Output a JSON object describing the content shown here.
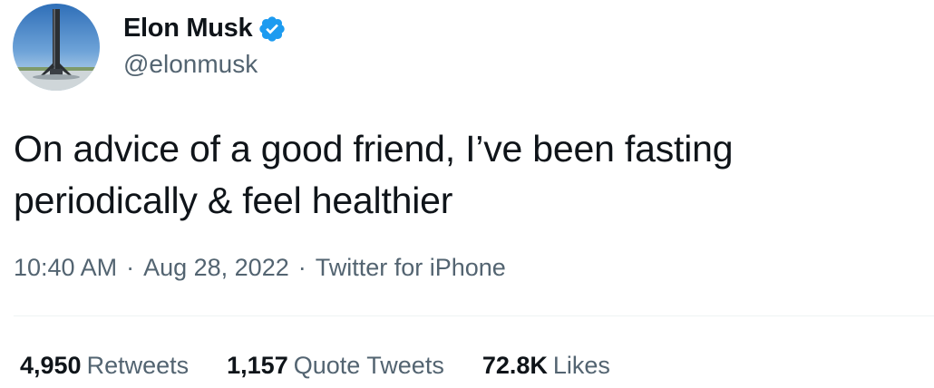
{
  "author": {
    "display_name": "Elon Musk",
    "handle": "@elonmusk",
    "verified": true,
    "verified_color": "#1d9bf0",
    "avatar_icon": "rocket-booster-avatar"
  },
  "tweet": {
    "text_line1": "On advice of a good friend, I’ve been fasting",
    "text_line2": "periodically & feel healthier"
  },
  "meta": {
    "time": "10:40 AM",
    "separator": "·",
    "date": "Aug 28, 2022",
    "source": "Twitter for iPhone"
  },
  "stats": {
    "retweets_count": "4,950",
    "retweets_label": "Retweets",
    "quote_tweets_count": "1,157",
    "quote_tweets_label": "Quote Tweets",
    "likes_count": "72.8K",
    "likes_label": "Likes"
  },
  "colors": {
    "text_primary": "#0f1419",
    "text_secondary": "#536471",
    "divider": "#eff3f4"
  }
}
